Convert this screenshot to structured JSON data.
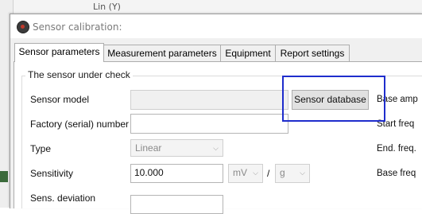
{
  "background": {
    "series_label": "Lin (Y)"
  },
  "window": {
    "title": "Sensor calibration:"
  },
  "tabs": [
    {
      "label": "Sensor parameters",
      "active": true
    },
    {
      "label": "Measurement parameters",
      "active": false
    },
    {
      "label": "Equipment",
      "active": false
    },
    {
      "label": "Report settings",
      "active": false
    }
  ],
  "group": {
    "title": "The sensor under check",
    "fields": {
      "sensor_model": {
        "label": "Sensor model",
        "value": ""
      },
      "serial_number": {
        "label": "Factory (serial) number",
        "value": ""
      },
      "type": {
        "label": "Type",
        "value": "Linear"
      },
      "sensitivity": {
        "label": "Sensitivity",
        "value": "10.000",
        "unit_num": "mV",
        "separator": "/",
        "unit_den": "g"
      },
      "sens_deviation": {
        "label": "Sens. deviation"
      }
    },
    "sensor_database_button": "Sensor database",
    "right_labels": [
      "Base amp",
      "Start freq",
      "End. freq.",
      "Base freq"
    ]
  },
  "colors": {
    "highlight_box": "#1f2dcc"
  }
}
